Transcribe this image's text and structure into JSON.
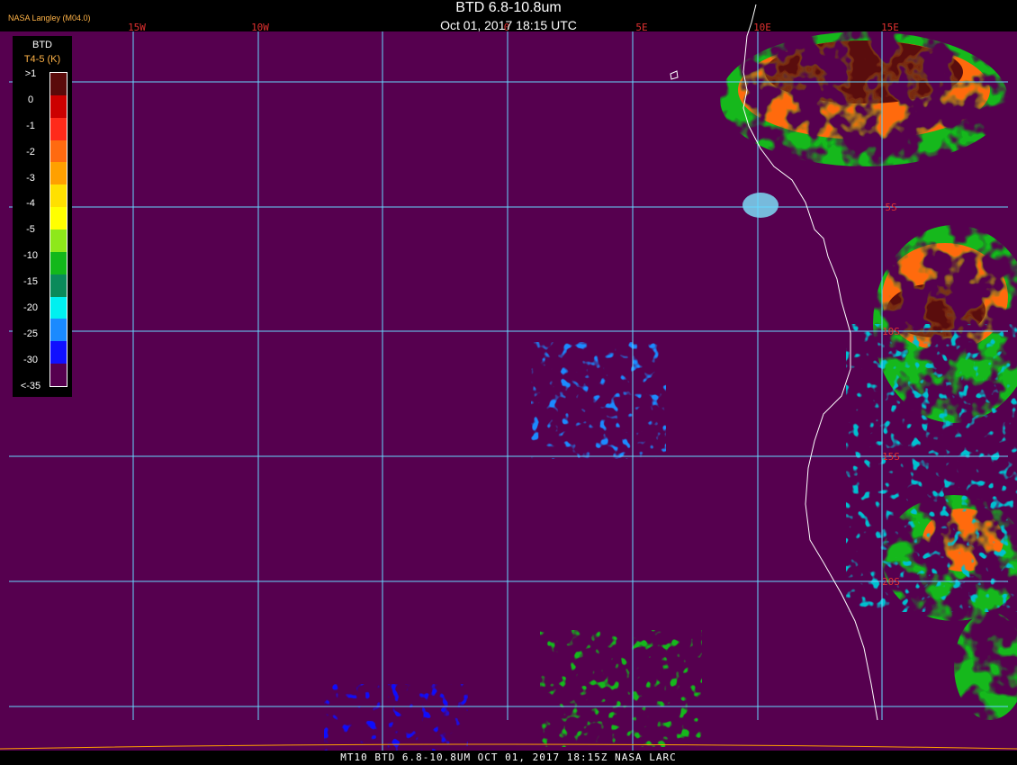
{
  "header": {
    "title": "BTD 6.8-10.8um",
    "datetime": "Oct 01, 2017 18:15 UTC",
    "provider": "NASA Langley (M04.0)"
  },
  "footer": {
    "text": "MT10  BTD 6.8-10.8UM  OCT 01, 2017 18:15Z  NASA LARC"
  },
  "colors": {
    "ocean": "#56004f",
    "grid": "#66d9ff",
    "coast": "#ffffff",
    "lon_label": "#e03030",
    "lat_label": "#e03030"
  },
  "grid_labels": {
    "longitudes": [
      "15W",
      "10W",
      "0",
      "5E",
      "10E",
      "15E"
    ],
    "latitudes": [
      "5S",
      "10S",
      "15S",
      "20S"
    ]
  },
  "legend": {
    "title": "BTD",
    "units": "T4-5 (K)",
    "ticks": [
      ">1",
      "0",
      "-1",
      "-2",
      "-3",
      "-4",
      "-5",
      "-10",
      "-15",
      "-20",
      "-25",
      "-30",
      "<-35"
    ],
    "swatches": [
      "#5a0a0a",
      "#cc0000",
      "#ff2a1a",
      "#ff6a10",
      "#ffa000",
      "#ffe000",
      "#ffff00",
      "#8ee81a",
      "#12b81a",
      "#0a8a5a",
      "#00f0f0",
      "#1a8aff",
      "#1010ff",
      "#56004f"
    ]
  }
}
